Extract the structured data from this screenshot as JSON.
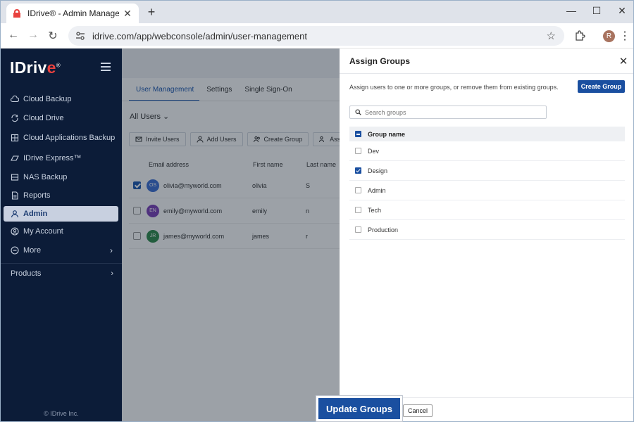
{
  "browser": {
    "tab_title": "IDrive® - Admin Management",
    "tab_close": "✕",
    "new_tab": "+",
    "url": "idrive.com/app/webconsole/admin/user-management",
    "profile_initial": "R",
    "min": "—",
    "max": "☐",
    "close": "✕"
  },
  "sidebar": {
    "logo_main": "IDriv",
    "logo_e": "e",
    "logo_reg": "®",
    "items": [
      {
        "label": "Cloud Backup",
        "icon": "cloud-upload-icon"
      },
      {
        "label": "Cloud Drive",
        "icon": "sync-icon"
      },
      {
        "label": "Cloud Applications Backup",
        "icon": "apps-icon"
      },
      {
        "label": "IDrive Express™",
        "icon": "express-icon"
      },
      {
        "label": "NAS Backup",
        "icon": "nas-icon"
      },
      {
        "label": "Reports",
        "icon": "report-icon"
      },
      {
        "label": "Admin",
        "icon": "user-admin-icon"
      },
      {
        "label": "My Account",
        "icon": "account-icon"
      },
      {
        "label": "More",
        "icon": "more-icon"
      }
    ],
    "products": "Products",
    "chev": "›",
    "copyright": "© IDrive Inc."
  },
  "main": {
    "subtabs": [
      "User Management",
      "Settings",
      "Single Sign-On"
    ],
    "all_users": "All Users  ⌄",
    "actions": [
      "Invite Users",
      "Add Users",
      "Create Group",
      "Assi"
    ],
    "headers": {
      "email": "Email address",
      "first": "First name",
      "last": "Last name"
    },
    "rows": [
      {
        "initials": "OS",
        "email": "olivia@myworld.com",
        "first": "olivia",
        "last": "S",
        "color": "#3b6fd4",
        "checked": true
      },
      {
        "initials": "EN",
        "email": "emily@myworld.com",
        "first": "emily",
        "last": "n",
        "color": "#7b3fb8",
        "checked": false
      },
      {
        "initials": "JR",
        "email": "james@myworld.com",
        "first": "james",
        "last": "r",
        "color": "#2e8a4a",
        "checked": false
      }
    ]
  },
  "drawer": {
    "title": "Assign Groups",
    "close": "✕",
    "description": "Assign users to one or more groups, or remove them from existing groups.",
    "create_group": "Create Group",
    "search_placeholder": "Search groups",
    "column_header": "Group name",
    "groups": [
      {
        "name": "Dev",
        "checked": false
      },
      {
        "name": "Design",
        "checked": true
      },
      {
        "name": "Admin",
        "checked": false
      },
      {
        "name": "Tech",
        "checked": false
      },
      {
        "name": "Production",
        "checked": false
      }
    ],
    "update_button": "Update Groups",
    "cancel_button": "Cancel"
  },
  "colors": {
    "accent": "#1a4fa0",
    "sidebar_bg": "#0c1c38",
    "brand_red": "#e8413e"
  }
}
